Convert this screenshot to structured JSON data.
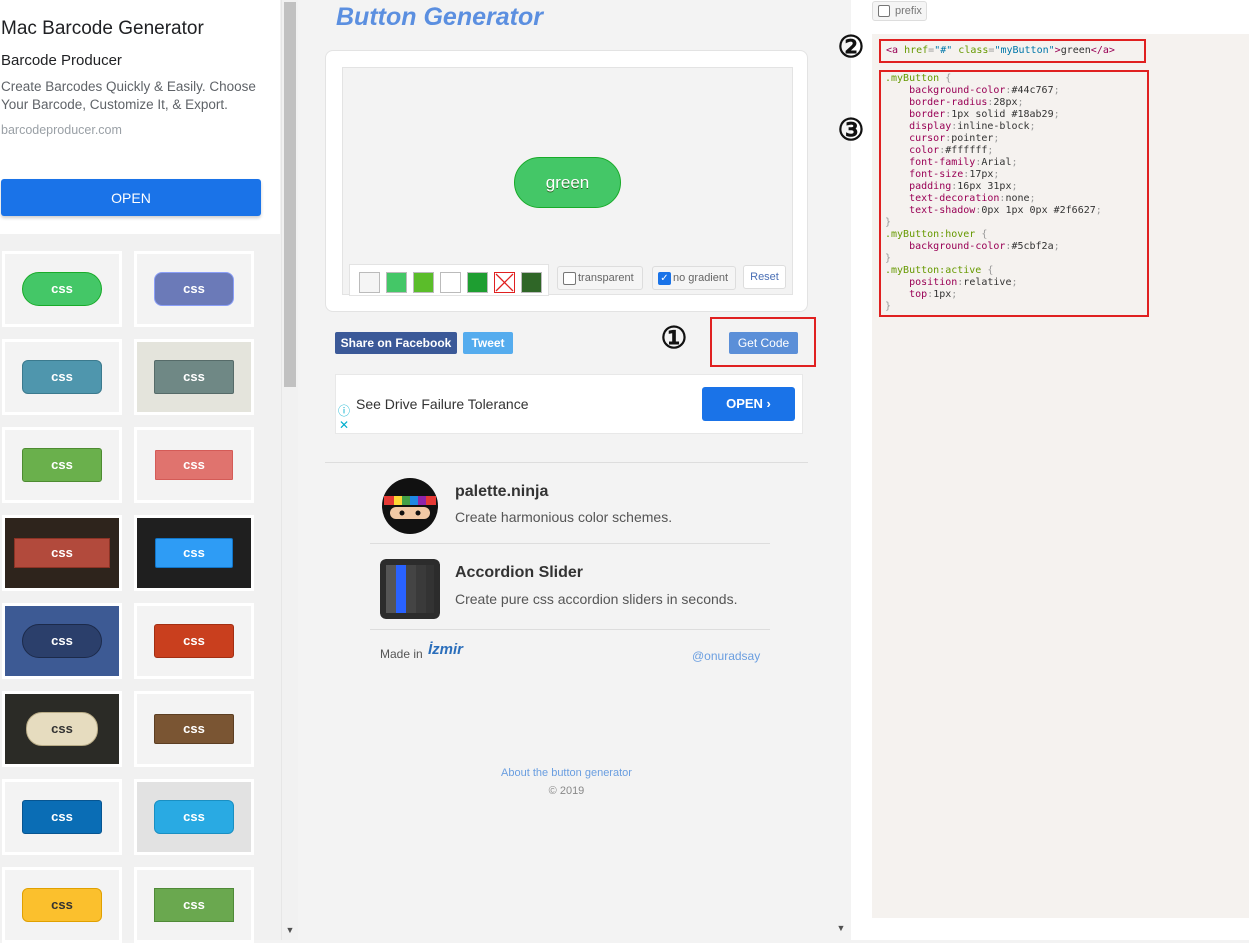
{
  "ad_top": {
    "title": "Mac Barcode Generator",
    "subtitle": "Barcode Producer",
    "description": "Create Barcodes Quickly & Easily. Choose Your Barcode, Customize It, & Export.",
    "domain": "barcodeproducer.com",
    "cta": "OPEN"
  },
  "gallery": {
    "tile_label": "css",
    "tiles": [
      {
        "bg": "#f3f3f3",
        "btn": "#44c767",
        "border": "#18ab29",
        "radius": "28px",
        "text": "#ffffff"
      },
      {
        "bg": "#f3f3f3",
        "btn": "#6b7ab8",
        "border": "#8a9ef7",
        "radius": "8px",
        "text": "#ffffff"
      },
      {
        "bg": "#f3f3f3",
        "btn": "#4f96ad",
        "border": "#3b7a8e",
        "radius": "6px",
        "text": "#ffffff"
      },
      {
        "bg": "#e4e4dc",
        "btn": "#6f8885",
        "border": "#566b69",
        "radius": "2px",
        "text": "#ffffff"
      },
      {
        "bg": "#f3f3f3",
        "btn": "#6ab04c",
        "border": "#4d8b31",
        "radius": "3px",
        "text": "#ffffff"
      },
      {
        "bg": "#f3f3f3",
        "btn": "#e0736e",
        "border": "#d45b57",
        "radius": "1px",
        "text": "#ffffff"
      },
      {
        "bg": "#2e241c",
        "btn": "#b24a3c",
        "border": "#8c3325",
        "radius": "0px",
        "text": "#ffffff"
      },
      {
        "bg": "#1f1f1f",
        "btn": "#2e9cf5",
        "border": "#1175c8",
        "radius": "2px",
        "text": "#ffffff"
      },
      {
        "bg": "#3d5a94",
        "btn": "#2b3f6b",
        "border": "#1c2a4a",
        "radius": "20px",
        "text": "#ffffff"
      },
      {
        "bg": "#f3f3f3",
        "btn": "#c93f1e",
        "border": "#a32e12",
        "radius": "3px",
        "text": "#ffffff"
      },
      {
        "bg": "#2b2b26",
        "btn": "#e6dcbf",
        "border": "#b8ab86",
        "radius": "16px",
        "text": "#333333"
      },
      {
        "bg": "#f3f3f3",
        "btn": "#7a5533",
        "border": "#5c3e22",
        "radius": "2px",
        "text": "#ffffff"
      },
      {
        "bg": "#f3f3f3",
        "btn": "#0a6db5",
        "border": "#075591",
        "radius": "3px",
        "text": "#ffffff"
      },
      {
        "bg": "#e2e2e2",
        "btn": "#29aae3",
        "border": "#1a8fc2",
        "radius": "6px",
        "text": "#ffffff"
      },
      {
        "bg": "#f3f3f3",
        "btn": "#fbc02d",
        "border": "#e0a000",
        "radius": "6px",
        "text": "#333333"
      },
      {
        "bg": "#f3f3f3",
        "btn": "#6aa84f",
        "border": "#4f8a37",
        "radius": "0px",
        "text": "#ffffff"
      }
    ]
  },
  "main": {
    "title": "Button Generator",
    "preview_button_label": "green",
    "swatch_colors": [
      "#f5f5f5",
      "#44c767",
      "#5bbd2a",
      "#ffffff",
      "#1e9e31",
      "#ffffff",
      "#2f6627"
    ],
    "transparent_label": "transparent",
    "no_gradient_label": "no gradient",
    "reset_label": "Reset",
    "share_facebook": "Share on Facebook",
    "tweet": "Tweet",
    "get_code": "Get Code",
    "markers": {
      "one": "①",
      "two": "②",
      "three": "③"
    }
  },
  "ad_mid": {
    "text": "See Drive Failure Tolerance",
    "cta": "OPEN ›"
  },
  "promos": [
    {
      "title": "palette.ninja",
      "desc": "Create harmonious color schemes."
    },
    {
      "title": "Accordion Slider",
      "desc": "Create pure css accordion sliders in seconds."
    }
  ],
  "footer": {
    "made_in": "Made in",
    "city": "İzmir",
    "twitter": "@onuradsay",
    "about": "About the button generator",
    "copyright": "© 2019"
  },
  "code": {
    "prefix_label": "prefix",
    "html_snippet": "<a href=\"#\" class=\"myButton\">green</a>",
    "css_lines": [
      ".myButton {",
      "\tbackground-color:#44c767;",
      "\tborder-radius:28px;",
      "\tborder:1px solid #18ab29;",
      "\tdisplay:inline-block;",
      "\tcursor:pointer;",
      "\tcolor:#ffffff;",
      "\tfont-family:Arial;",
      "\tfont-size:17px;",
      "\tpadding:16px 31px;",
      "\ttext-decoration:none;",
      "\ttext-shadow:0px 1px 0px #2f6627;",
      "}",
      ".myButton:hover {",
      "\tbackground-color:#5cbf2a;",
      "}",
      ".myButton:active {",
      "\tposition:relative;",
      "\ttop:1px;",
      "}"
    ]
  },
  "colors": {
    "accent": "#5b8fe0",
    "annotation_red": "#e02020",
    "preview_green": "#44c767"
  }
}
